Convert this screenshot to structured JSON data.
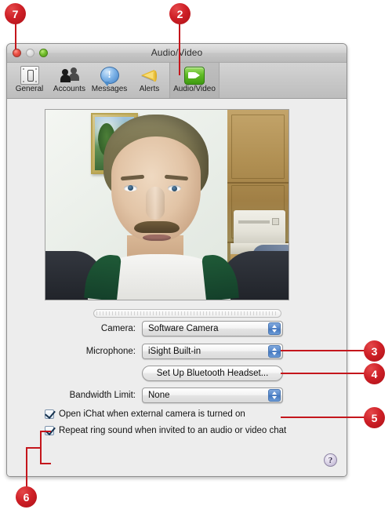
{
  "window": {
    "title": "Audio/Video",
    "traffic_lights": [
      "close",
      "minimize",
      "zoom"
    ]
  },
  "toolbar": {
    "items": [
      {
        "label": "General",
        "icon": "general-icon",
        "selected": false
      },
      {
        "label": "Accounts",
        "icon": "accounts-icon",
        "selected": false
      },
      {
        "label": "Messages",
        "icon": "messages-icon",
        "selected": false
      },
      {
        "label": "Alerts",
        "icon": "alerts-icon",
        "selected": false
      },
      {
        "label": "Audio/Video",
        "icon": "audio-video-icon",
        "selected": true
      }
    ]
  },
  "preview": {
    "name": "video-preview",
    "grip_name": "video-grip-slider"
  },
  "settings": {
    "camera_label": "Camera:",
    "camera_value": "Software Camera",
    "microphone_label": "Microphone:",
    "microphone_value": "iSight Built-in",
    "bluetooth_button": "Set Up Bluetooth Headset...",
    "bandwidth_label": "Bandwidth Limit:",
    "bandwidth_value": "None",
    "checkbox_open_ichat": "Open iChat when external camera is turned on",
    "checkbox_repeat_ring": "Repeat ring sound when invited to an audio or video chat",
    "help_label": "?"
  },
  "callouts": [
    {
      "number": "7",
      "target": "close-button"
    },
    {
      "number": "2",
      "target": "audio-video-toolbar-tab"
    },
    {
      "number": "3",
      "target": "camera-popup"
    },
    {
      "number": "4",
      "target": "microphone-popup"
    },
    {
      "number": "5",
      "target": "bandwidth-popup"
    },
    {
      "number": "6",
      "target": "checkbox-group"
    }
  ],
  "colors": {
    "callout_red": "#c4161c",
    "accent_blue": "#5687c9",
    "toolbar_selected_green": "#5fbb24"
  }
}
